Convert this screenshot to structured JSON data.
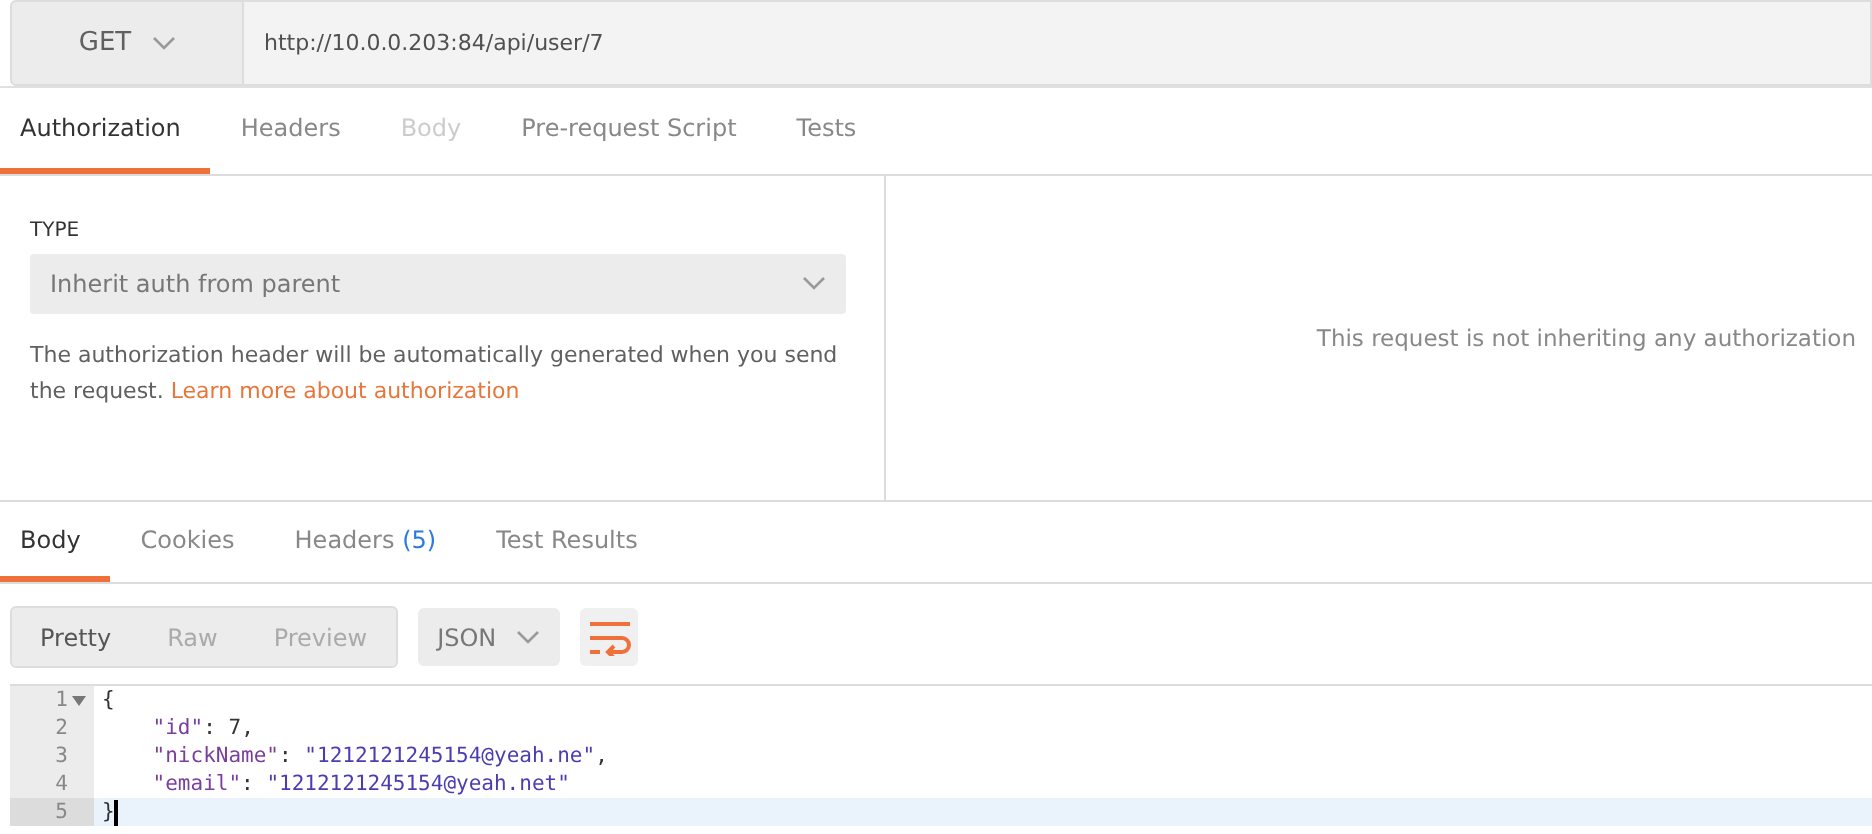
{
  "request": {
    "method": "GET",
    "url": "http://10.0.0.203:84/api/user/7"
  },
  "request_tabs": [
    {
      "label": "Authorization",
      "selected": true,
      "disabled": false
    },
    {
      "label": "Headers",
      "selected": false,
      "disabled": false
    },
    {
      "label": "Body",
      "selected": false,
      "disabled": true
    },
    {
      "label": "Pre-request Script",
      "selected": false,
      "disabled": false
    },
    {
      "label": "Tests",
      "selected": false,
      "disabled": false
    }
  ],
  "auth": {
    "type_label": "TYPE",
    "type_value": "Inherit auth from parent",
    "description": "The authorization header will be automatically generated when you send the request.",
    "link": "Learn more about authorization",
    "message": "This request is not inheriting any authorization"
  },
  "response_tabs": [
    {
      "label": "Body",
      "selected": true
    },
    {
      "label": "Cookies",
      "selected": false
    },
    {
      "label": "Headers",
      "count": "(5)",
      "selected": false
    },
    {
      "label": "Test Results",
      "selected": false
    }
  ],
  "view_modes": [
    {
      "label": "Pretty",
      "selected": true
    },
    {
      "label": "Raw",
      "selected": false
    },
    {
      "label": "Preview",
      "selected": false
    }
  ],
  "format": "JSON",
  "code_lines": [
    {
      "number": "1",
      "foldable": true,
      "current": false,
      "segments": [
        {
          "kind": "punct",
          "text": "{"
        }
      ]
    },
    {
      "number": "2",
      "foldable": false,
      "current": false,
      "segments": [
        {
          "kind": "key",
          "text": "    \"id\""
        },
        {
          "kind": "punct",
          "text": ": "
        },
        {
          "kind": "number",
          "text": "7"
        },
        {
          "kind": "punct",
          "text": ","
        }
      ]
    },
    {
      "number": "3",
      "foldable": false,
      "current": false,
      "segments": [
        {
          "kind": "key",
          "text": "    \"nickName\""
        },
        {
          "kind": "punct",
          "text": ": "
        },
        {
          "kind": "string",
          "text": "\"1212121245154@yeah.ne\""
        },
        {
          "kind": "punct",
          "text": ","
        }
      ]
    },
    {
      "number": "4",
      "foldable": false,
      "current": false,
      "segments": [
        {
          "kind": "key",
          "text": "    \"email\""
        },
        {
          "kind": "punct",
          "text": ": "
        },
        {
          "kind": "string",
          "text": "\"1212121245154@yeah.net\""
        }
      ]
    },
    {
      "number": "5",
      "foldable": false,
      "current": true,
      "segments": [
        {
          "kind": "punct",
          "text": "}"
        }
      ]
    }
  ]
}
